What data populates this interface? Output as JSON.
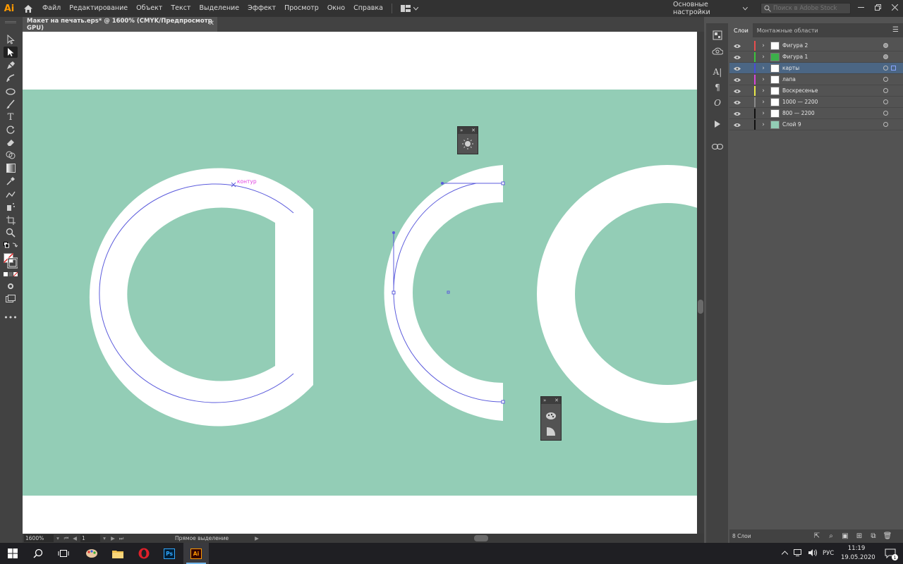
{
  "app": {
    "logo": "Ai",
    "menus": [
      "Файл",
      "Редактирование",
      "Объект",
      "Текст",
      "Выделение",
      "Эффект",
      "Просмотр",
      "Окно",
      "Справка"
    ],
    "workspace": "Основные настройки",
    "stock_search_placeholder": "Поиск в Adobe Stock"
  },
  "document": {
    "tab_title": "Макет на печать.eps* @ 1600% (CMYK/Предпросмотр GPU)",
    "anchor_label": "контур",
    "colors": {
      "teal": "#93cdb6",
      "path": "#5b5bdc",
      "anchor_label": "#e040e0"
    }
  },
  "statusbar": {
    "zoom": "1600%",
    "page": "1",
    "tool": "Прямое выделение"
  },
  "layers_panel": {
    "tabs": [
      "Слои",
      "Монтажные области"
    ],
    "layers": [
      {
        "name": "Фигура 2",
        "color": "#e84e4e",
        "thumb": "white",
        "target_filled": true,
        "selected": false
      },
      {
        "name": "Фигура 1",
        "color": "#3cc43c",
        "thumb": "green",
        "target_filled": true,
        "selected": false
      },
      {
        "name": "карты",
        "color": "#4a4ad8",
        "thumb": "white",
        "target_filled": false,
        "selected": true
      },
      {
        "name": "лапа",
        "color": "#d846d8",
        "thumb": "white",
        "target_filled": false,
        "selected": false
      },
      {
        "name": "Воскресенье",
        "color": "#e8e84a",
        "thumb": "white",
        "target_filled": false,
        "selected": false
      },
      {
        "name": "1000 — 2200",
        "color": "#8a8a8a",
        "thumb": "white",
        "target_filled": false,
        "selected": false
      },
      {
        "name": "800 — 2200",
        "color": "#111111",
        "thumb": "white",
        "target_filled": false,
        "selected": false
      },
      {
        "name": "Слой 9",
        "color": "#111111",
        "thumb": "teal",
        "target_filled": false,
        "selected": false
      }
    ],
    "count": "8 Слои"
  },
  "taskbar": {
    "language": "РУС",
    "time": "11:19",
    "date": "19.05.2020",
    "notifications": "1"
  }
}
